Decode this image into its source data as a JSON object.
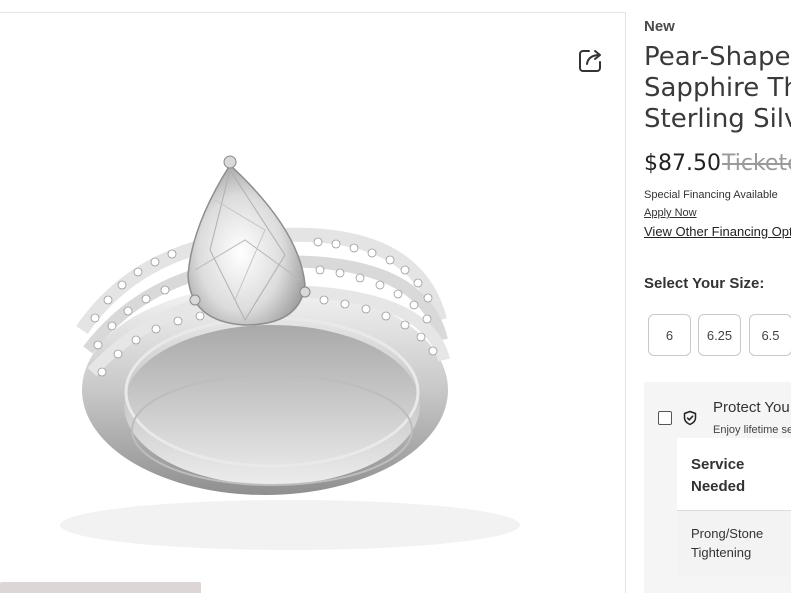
{
  "product": {
    "badge": "New",
    "title_lines": [
      "Pear-Shaped",
      "Sapphire Thr",
      "Sterling Silve"
    ],
    "price": "$87.50",
    "old_price": "Tickete"
  },
  "financing": {
    "text": "Special Financing Available",
    "apply_label": "Apply Now",
    "other_label": "View Other Financing Opt"
  },
  "sizes": {
    "label": "Select Your Size:",
    "options": [
      "6",
      "6.25",
      "6.5"
    ]
  },
  "protection": {
    "title": "Protect You",
    "subtitle": "Enjoy lifetime se",
    "table_header": "Service Needed",
    "rows": [
      "Prong/Stone Tightening"
    ]
  },
  "icons": {
    "share": "share-icon",
    "shield": "shield-check-icon"
  },
  "colors": {
    "page_bg": "#ffffff",
    "text": "#2b2b2b",
    "muted": "#9a9a9a",
    "panel": "#f5f5f5"
  }
}
